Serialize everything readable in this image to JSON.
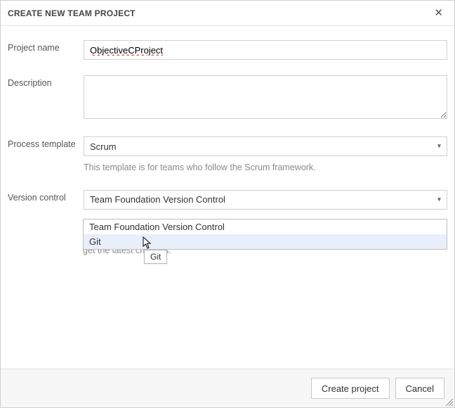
{
  "header": {
    "title": "CREATE NEW TEAM PROJECT"
  },
  "labels": {
    "project_name": "Project name",
    "description": "Description",
    "process_template": "Process template",
    "version_control": "Version control"
  },
  "fields": {
    "project_name_value": "ObjectiveCProject",
    "description_value": "",
    "process_template_selected": "Scrum",
    "process_template_hint": "This template is for teams who follow the Scrum framework.",
    "version_control_selected": "Team Foundation Version Control",
    "version_control_options": [
      "Team Foundation Version Control",
      "Git"
    ],
    "version_control_hint_partial": "get the latest changes."
  },
  "tooltip": "Git",
  "footer": {
    "create": "Create project",
    "cancel": "Cancel"
  }
}
